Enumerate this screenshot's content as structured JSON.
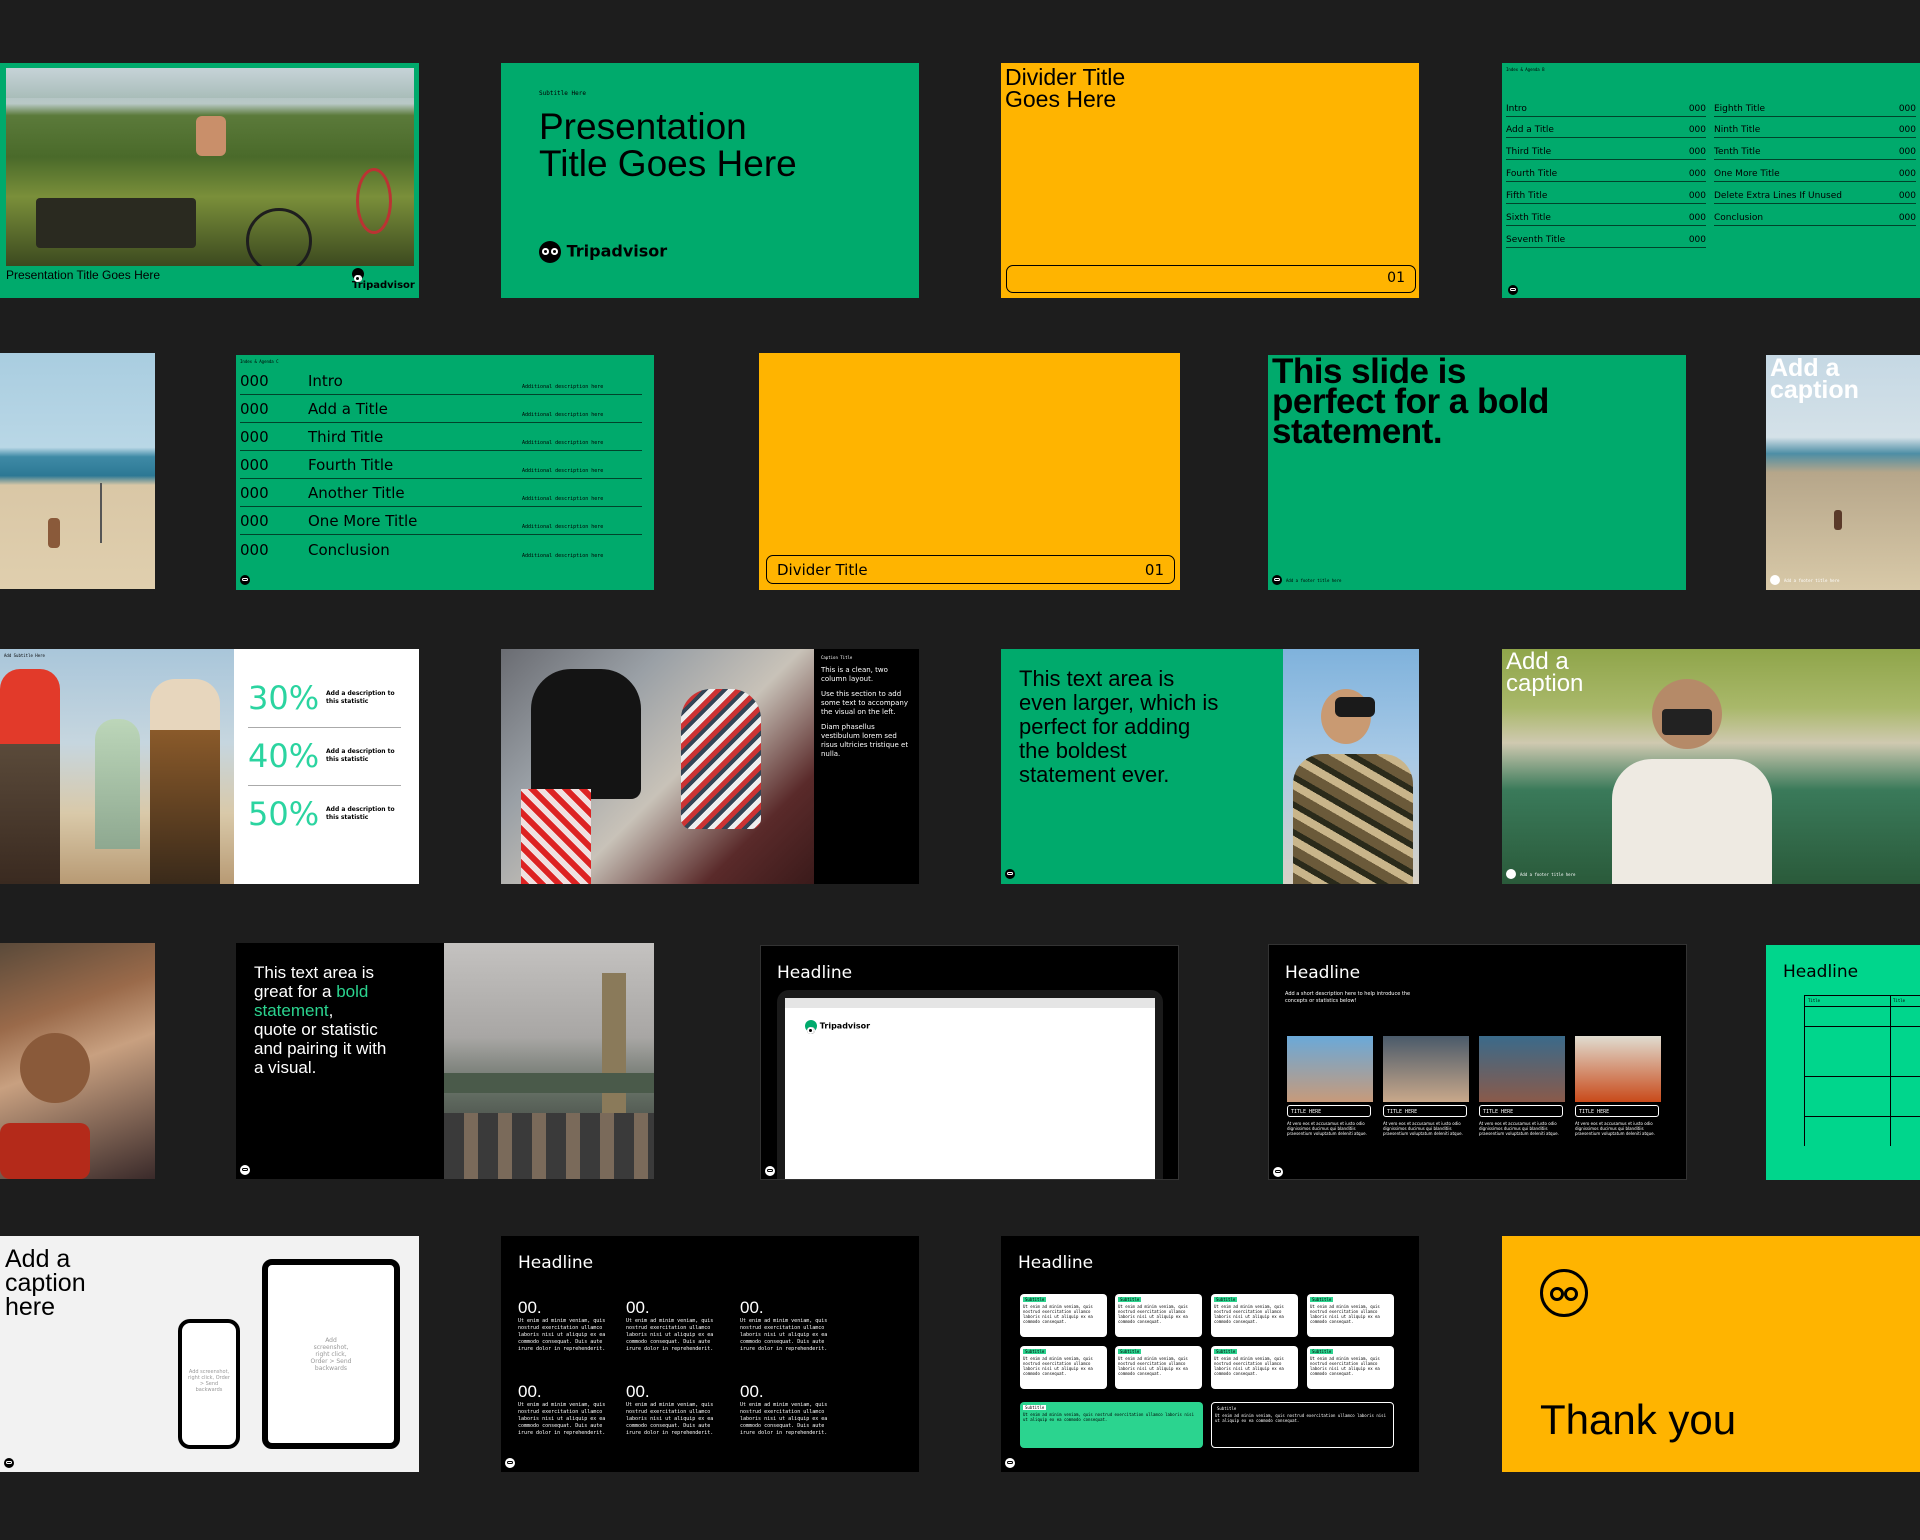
{
  "colors": {
    "bg": "#1d1d1d",
    "green": "#00aa6c",
    "mint": "#00d68c",
    "amber": "#ffb400",
    "accent": "#2bd4a0"
  },
  "slides": {
    "s1": {
      "caption": "Presentation Title Goes Here",
      "brand": "Tripadvisor"
    },
    "s2": {
      "subtitle": "Subtitle Here",
      "title_l1": "Presentation",
      "title_l2": "Title Goes Here",
      "brand": "Tripadvisor"
    },
    "s3": {
      "title_l1": "Divider Title",
      "title_l2": "Goes Here",
      "number": "01"
    },
    "s4": {
      "header": "Index & Agenda B",
      "left": [
        {
          "t": "Intro",
          "n": "000"
        },
        {
          "t": "Add a Title",
          "n": "000"
        },
        {
          "t": "Third Title",
          "n": "000"
        },
        {
          "t": "Fourth Title",
          "n": "000"
        },
        {
          "t": "Fifth Title",
          "n": "000"
        },
        {
          "t": "Sixth Title",
          "n": "000"
        },
        {
          "t": "Seventh Title",
          "n": "000"
        }
      ],
      "right": [
        {
          "t": "Eighth Title",
          "n": "000"
        },
        {
          "t": "Ninth Title",
          "n": "000"
        },
        {
          "t": "Tenth Title",
          "n": "000"
        },
        {
          "t": "One More Title",
          "n": "000"
        },
        {
          "t": "Delete Extra Lines If Unused",
          "n": "000"
        },
        {
          "t": "Conclusion",
          "n": "000"
        }
      ]
    },
    "s6": {
      "header": "Index & Agenda C",
      "rows": [
        {
          "n": "000",
          "t": "Intro",
          "d": "Additional description here"
        },
        {
          "n": "000",
          "t": "Add a Title",
          "d": "Additional description here"
        },
        {
          "n": "000",
          "t": "Third Title",
          "d": "Additional description here"
        },
        {
          "n": "000",
          "t": "Fourth Title",
          "d": "Additional description here"
        },
        {
          "n": "000",
          "t": "Another Title",
          "d": "Additional description here"
        },
        {
          "n": "000",
          "t": "One More Title",
          "d": "Additional description here"
        },
        {
          "n": "000",
          "t": "Conclusion",
          "d": "Additional description here"
        }
      ]
    },
    "s7": {
      "title": "Divider Title",
      "number": "01"
    },
    "s8": {
      "l1": "This slide is",
      "l2": "perfect for a bold",
      "l3": "statement.",
      "footer": "Add a footer title here"
    },
    "s9": {
      "l1": "Add a",
      "l2": "caption",
      "footer": "Add a footer title here"
    },
    "s10": {
      "label": "Add Subtitle Here",
      "stats": [
        {
          "p": "30%",
          "d1": "Add a description to",
          "d2": "this statistic"
        },
        {
          "p": "40%",
          "d1": "Add a description to",
          "d2": "this statistic"
        },
        {
          "p": "50%",
          "d1": "Add a description to",
          "d2": "this statistic"
        }
      ]
    },
    "s11": {
      "label": "Caption Title",
      "p1": "This is a clean, two column layout.",
      "p2": "Use this section to add some text to accompany the visual on the left.",
      "p3": "Diam phasellus vestibulum lorem sed risus ultricies tristique et nulla."
    },
    "s12": {
      "l1": "This text area is",
      "l2": "even larger, which is",
      "l3": "perfect for adding",
      "l4": "the boldest",
      "l5": "statement ever."
    },
    "s13": {
      "l1": "Add a",
      "l2": "caption",
      "footer": "Add a footer title here"
    },
    "s15": {
      "l1": "This text area is",
      "l2a": "great for a ",
      "l2b": "bold",
      "l3a": "statement",
      ",": ",",
      "l4": "quote or statistic",
      "l5": "and pairing it with",
      "l6": "a visual."
    },
    "s16": {
      "headline": "Headline",
      "brand": "Tripadvisor"
    },
    "s17": {
      "headline": "Headline",
      "desc1": "Add a short description here to help introduce the",
      "desc2": "concepts or statistics below!",
      "cards": [
        {
          "t": "TITLE HERE"
        },
        {
          "t": "TITLE HERE"
        },
        {
          "t": "TITLE HERE"
        },
        {
          "t": "TITLE HERE"
        }
      ],
      "body": "At vero eos et accusamus et iusto odio dignissimos ducimus qui blanditiis praesentium voluptatum deleniti atque."
    },
    "s18": {
      "headline": "Headline",
      "col1": "Title",
      "col2": "Title"
    },
    "s19": {
      "l1": "Add a",
      "l2": "caption",
      "l3": "here",
      "phone_hint": "Add screenshot, right click, Order > Send backwards",
      "tablet_hint": "Add screenshot, right click, Order > Send backwards"
    },
    "s20": {
      "headline": "Headline",
      "num": "00.",
      "body": "Ut enim ad minim veniam, quis nostrud exercitation ullamco laboris nisi ut aliquip ex ea commodo consequat. Duis aute irure dolor in reprehenderit."
    },
    "s21": {
      "headline": "Headline",
      "label": "Subtitle",
      "body": "Ut enim ad minim veniam, quis nostrud exercitation ullamco laboris nisi ut aliquip ex ea commodo consequat."
    },
    "s22": {
      "text": "Thank you"
    }
  }
}
